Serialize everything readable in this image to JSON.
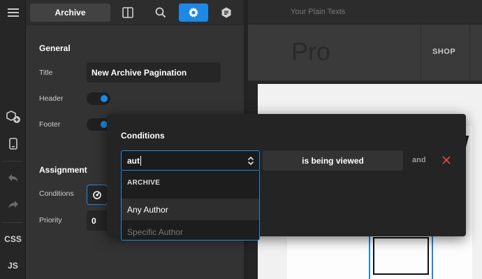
{
  "rail": {
    "css_label": "CSS",
    "js_label": "JS"
  },
  "panel": {
    "tabs": {
      "archive_label": "Archive"
    },
    "general": {
      "section_title": "General",
      "title_label": "Title",
      "title_value": "New Archive Pagination",
      "header_label": "Header",
      "footer_label": "Footer",
      "header_enabled": true,
      "footer_enabled": true
    },
    "assignment": {
      "section_title": "Assignment",
      "conditions_label": "Conditions",
      "priority_label": "Priority",
      "priority_value": "0"
    }
  },
  "preview": {
    "top_text": "Your Plain Texts",
    "logo_text": "Pro",
    "shop_label": "SHOP",
    "big_letter": "w"
  },
  "conditions_popup": {
    "title": "Conditions",
    "search_value": "aut",
    "dropdown_group": "ARCHIVE",
    "options": [
      "Any Author",
      "Specific Author"
    ],
    "condition_value": "is being viewed",
    "and_label": "and"
  },
  "colors": {
    "accent": "#1e88e5",
    "danger": "#e24b4b",
    "panel_bg": "#333333",
    "popup_bg": "#242424"
  }
}
